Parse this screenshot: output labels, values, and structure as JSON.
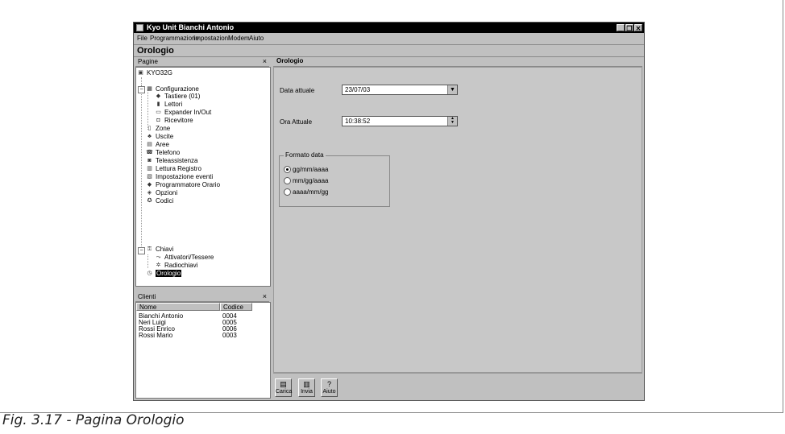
{
  "window": {
    "title": "Kyo Unit   Bianchi Antonio",
    "minimize_glyph": "_",
    "restore_glyph": "❐",
    "close_glyph": "✕"
  },
  "menu": [
    "File",
    "Programmazione",
    "Impostazioni",
    "Modem",
    "Aiuto"
  ],
  "page_title": "Orologio",
  "pagine_panel": {
    "title": "Pagine",
    "close": "×"
  },
  "tree": [
    {
      "label": "KYO32G",
      "icon": "panel-icon"
    },
    {
      "label": "Configurazione",
      "icon": "config-icon"
    },
    {
      "label": "Tastiere (01)",
      "icon": "keypad-icon"
    },
    {
      "label": "Lettori",
      "icon": "reader-icon"
    },
    {
      "label": "Expander In/Out",
      "icon": "expander-icon"
    },
    {
      "label": "Ricevitore",
      "icon": "receiver-icon"
    },
    {
      "label": "Zone",
      "icon": "zone-icon"
    },
    {
      "label": "Uscite",
      "icon": "output-icon"
    },
    {
      "label": "Aree",
      "icon": "area-icon"
    },
    {
      "label": "Telefono",
      "icon": "phone-icon"
    },
    {
      "label": "Teleassistenza",
      "icon": "teleassist-icon"
    },
    {
      "label": "Lettura Registro",
      "icon": "log-icon"
    },
    {
      "label": "Impostazione eventi",
      "icon": "events-icon"
    },
    {
      "label": "Programmatore Orario",
      "icon": "scheduler-icon"
    },
    {
      "label": "Opzioni",
      "icon": "options-icon"
    },
    {
      "label": "Codici",
      "icon": "codes-icon"
    },
    {
      "label": "Chiavi",
      "icon": "keys-icon"
    },
    {
      "label": "Attivatori/Tessere",
      "icon": "activator-icon"
    },
    {
      "label": "Radiochiavi",
      "icon": "radiokey-icon"
    },
    {
      "label": "Orologio",
      "icon": "clock-icon"
    }
  ],
  "clients_panel": {
    "title": "Clienti",
    "close": "×",
    "columns": [
      "Nome",
      "Codice"
    ],
    "rows": [
      [
        "Bianchi Antonio",
        "0004"
      ],
      [
        "Neri Luigi",
        "0005"
      ],
      [
        "Rossi Enrico",
        "0006"
      ],
      [
        "Rossi Mario",
        "0003"
      ]
    ]
  },
  "orologio": {
    "header": "Orologio",
    "date_label": "Data attuale",
    "date_value": "23/07/03",
    "time_label": "Ora Attuale",
    "time_value": "10:38:52",
    "format_group": "Formato data",
    "formats": [
      "gg/mm/aaaa",
      "mm/gg/aaaa",
      "aaaa/mm/gg"
    ],
    "selected_format_index": 0
  },
  "toolbar": [
    "Carica",
    "Invia",
    "Aiuto"
  ],
  "caption": "Fig. 3.17 - Pagina Orologio"
}
